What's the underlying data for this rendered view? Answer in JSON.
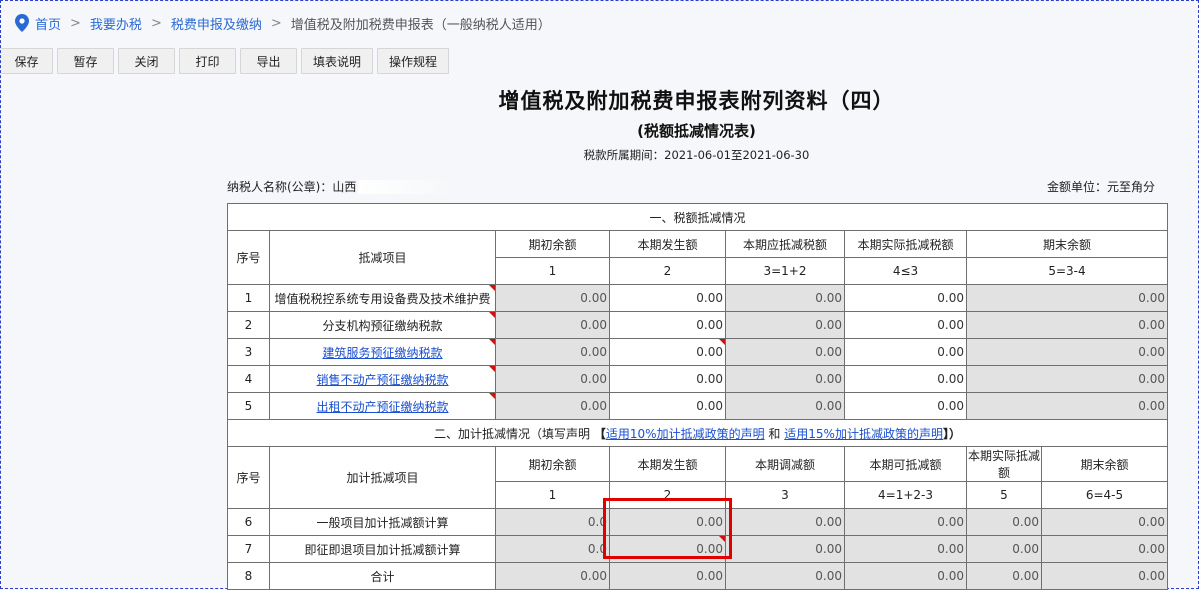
{
  "breadcrumb": {
    "home": "首页",
    "sep": ">",
    "items": [
      "我要办税",
      "税费申报及缴纳"
    ],
    "current": "增值税及附加税费申报表（一般纳税人适用）"
  },
  "toolbar": {
    "buttons": [
      "保存",
      "暂存",
      "关闭",
      "打印",
      "导出",
      "填表说明",
      "操作规程"
    ]
  },
  "header": {
    "title": "增值税及附加税费申报表附列资料（四）",
    "subtitle": "(税额抵减情况表)",
    "period": "税款所属期间：2021-06-01至2021-06-30",
    "taxpayer_label": "纳税人名称(公章)：山西",
    "unit": "金额单位：元至角分"
  },
  "section1": {
    "title": "一、税额抵减情况",
    "headers": {
      "seq": "序号",
      "item": "抵减项目",
      "cols": [
        "期初余额",
        "本期发生额",
        "本期应抵减税额",
        "本期实际抵减税额",
        "期末余额"
      ],
      "formulas": [
        "1",
        "2",
        "3=1+2",
        "4≤3",
        "5=3-4"
      ]
    },
    "rows": [
      {
        "seq": "1",
        "item": "增值税税控系统专用设备费及技术维护费",
        "link": false,
        "values": [
          "0.00",
          "0.00",
          "0.00",
          "0.00",
          "0.00"
        ]
      },
      {
        "seq": "2",
        "item": "分支机构预征缴纳税款",
        "link": false,
        "values": [
          "0.00",
          "0.00",
          "0.00",
          "0.00",
          "0.00"
        ]
      },
      {
        "seq": "3",
        "item": "建筑服务预征缴纳税款",
        "link": true,
        "values": [
          "0.00",
          "0.00",
          "0.00",
          "0.00",
          "0.00"
        ]
      },
      {
        "seq": "4",
        "item": "销售不动产预征缴纳税款",
        "link": true,
        "values": [
          "0.00",
          "0.00",
          "0.00",
          "0.00",
          "0.00"
        ]
      },
      {
        "seq": "5",
        "item": "出租不动产预征缴纳税款",
        "link": true,
        "values": [
          "0.00",
          "0.00",
          "0.00",
          "0.00",
          "0.00"
        ]
      }
    ]
  },
  "section2": {
    "title_prefix": "二、加计抵减情况（填写声明",
    "bracket_open": "【",
    "link1": "适用10%加计抵减政策的声明",
    "and": "和",
    "link2": "适用15%加计抵减政策的声明",
    "bracket_close": "】）",
    "headers": {
      "seq": "序号",
      "item": "加计抵减项目",
      "cols": [
        "期初余额",
        "本期发生额",
        "本期调减额",
        "本期可抵减额",
        "本期实际抵减额",
        "期末余额"
      ],
      "formulas": [
        "1",
        "2",
        "3",
        "4=1+2-3",
        "5",
        "6=4-5"
      ]
    },
    "rows": [
      {
        "seq": "6",
        "item": "一般项目加计抵减额计算",
        "values": [
          "0.0",
          "0.00",
          "0.00",
          "0.00",
          "0.00",
          "0.00"
        ]
      },
      {
        "seq": "7",
        "item": "即征即退项目加计抵减额计算",
        "values": [
          "0.0",
          "0.00",
          "0.00",
          "0.00",
          "0.00",
          "0.00"
        ]
      },
      {
        "seq": "8",
        "item": "合计",
        "values": [
          "0.00",
          "0.00",
          "0.00",
          "0.00",
          "0.00",
          "0.00"
        ]
      }
    ]
  },
  "colors": {
    "link": "#1a4fd0",
    "grey_cell": "#e2e2e2",
    "highlight": "#e10000",
    "frame": "#2b3fc7"
  },
  "icons": {
    "location": "location-pin-icon",
    "corner": "red-corner-triangle-icon"
  }
}
